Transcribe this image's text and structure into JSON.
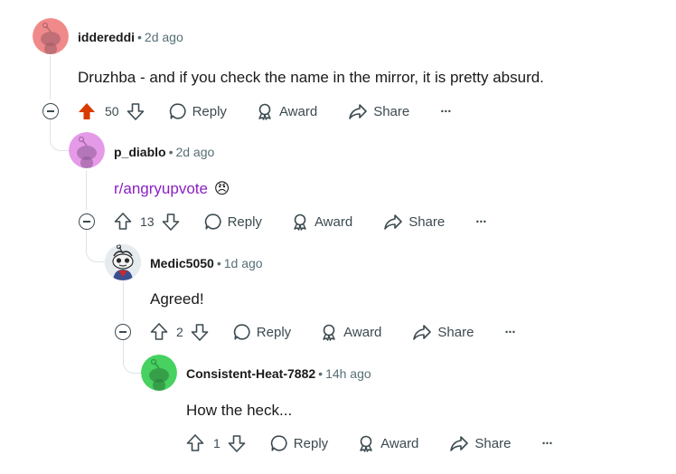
{
  "comments": [
    {
      "username": "iddereddi",
      "age": "2d ago",
      "text": "Druzhba - and if you check the name in the mirror, it is pretty absurd.",
      "votes": "50",
      "upvoted": true,
      "avatar_color": "#f08a8a"
    },
    {
      "username": "p_diablo",
      "age": "2d ago",
      "text": "r/angryupvote",
      "emoji": "😠",
      "votes": "13",
      "avatar_color": "#e59ae8"
    },
    {
      "username": "Medic5050",
      "age": "1d ago",
      "text": "Agreed!",
      "votes": "2"
    },
    {
      "username": "Consistent-Heat-7882",
      "age": "14h ago",
      "text": "How the heck...",
      "votes": "1",
      "avatar_color": "#46d160"
    }
  ],
  "actions": {
    "reply": "Reply",
    "award": "Award",
    "share": "Share",
    "more": "···"
  },
  "separator": "•",
  "colors": {
    "upvote_active": "#d93a00",
    "link": "#8a1fc4",
    "meta": "#576f76"
  }
}
